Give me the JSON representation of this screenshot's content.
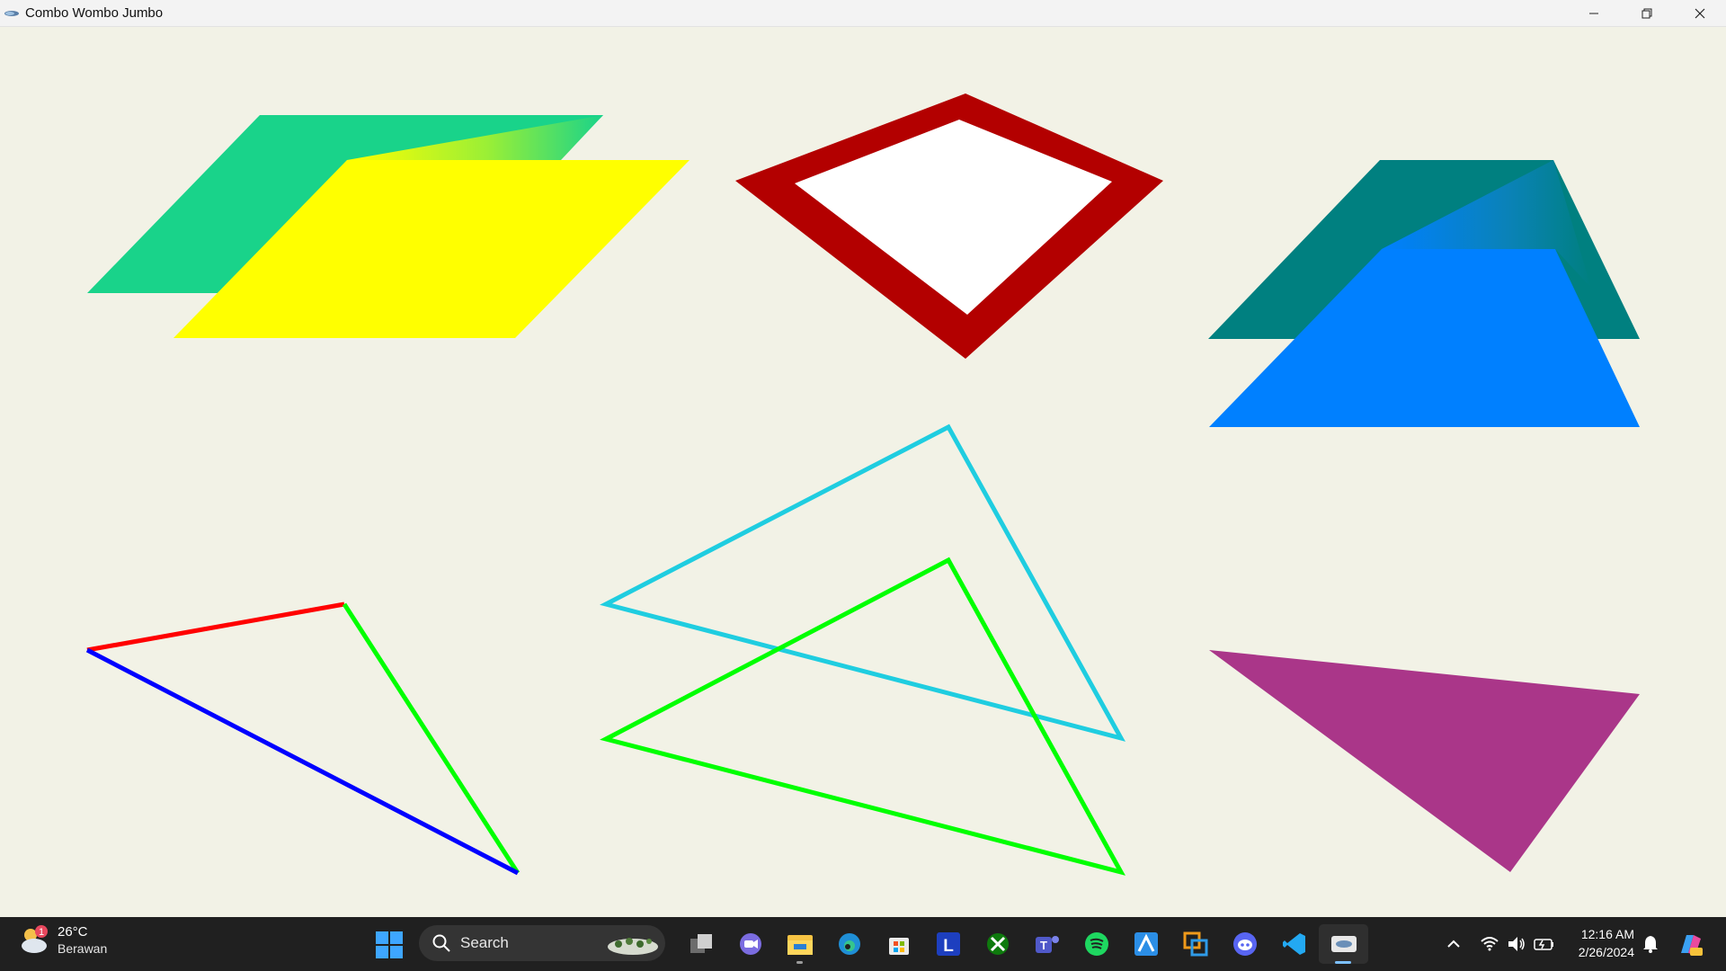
{
  "window": {
    "title": "Combo Wombo Jumbo",
    "controls": [
      "minimize",
      "restore",
      "close"
    ]
  },
  "canvas": {
    "background": "#f2f2e6",
    "shapes": [
      {
        "name": "parallelogram-back",
        "fill": "#19d38a"
      },
      {
        "name": "parallelogram-front",
        "fill": "#ffff00"
      },
      {
        "name": "diamond-outline",
        "stroke": "#b30000",
        "fill": "#ffffff"
      },
      {
        "name": "trapezoid-back",
        "fill": "#008080"
      },
      {
        "name": "trapezoid-front",
        "fill": "#0080ff"
      },
      {
        "name": "triangle-multicolor",
        "strokes": [
          "#ff0000",
          "#00ff00",
          "#0000ff"
        ]
      },
      {
        "name": "triangle-cyan-outline",
        "stroke": "#1fcde0"
      },
      {
        "name": "triangle-green-outline",
        "stroke": "#00ff00"
      },
      {
        "name": "triangle-purple-filled",
        "fill": "#aa3689"
      }
    ]
  },
  "taskbar": {
    "weather": {
      "temp": "26°C",
      "desc": "Berawan",
      "badge": "1"
    },
    "search": {
      "label": "Search"
    },
    "apps": [
      {
        "icon": "task-view-icon"
      },
      {
        "icon": "chat-icon"
      },
      {
        "icon": "file-explorer-icon"
      },
      {
        "icon": "edge-icon"
      },
      {
        "icon": "store-icon"
      },
      {
        "icon": "l-app-icon"
      },
      {
        "icon": "xbox-icon"
      },
      {
        "icon": "teams-icon"
      },
      {
        "icon": "spotify-icon"
      },
      {
        "icon": "drawing-app-icon"
      },
      {
        "icon": "remote-app-icon"
      },
      {
        "icon": "discord-icon"
      },
      {
        "icon": "vscode-icon"
      },
      {
        "icon": "opengl-app-icon"
      }
    ],
    "clock": {
      "time": "12:16 AM",
      "date": "2/26/2024"
    }
  }
}
